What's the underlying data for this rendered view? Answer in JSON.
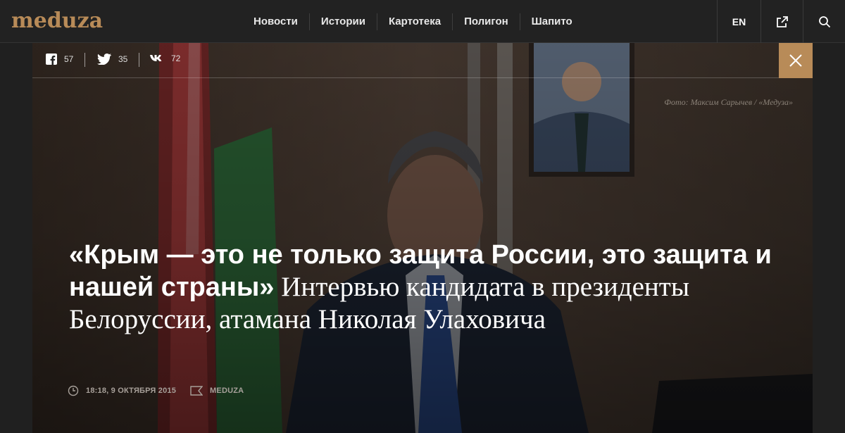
{
  "header": {
    "logo": "meduza",
    "nav": [
      "Новости",
      "Истории",
      "Картотека",
      "Полигон",
      "Шапито"
    ],
    "lang": "EN"
  },
  "share": {
    "facebook_count": "57",
    "twitter_count": "35",
    "vk_count": "72"
  },
  "article": {
    "photo_credit": "Фото: Максим Сарычев / «Медуза»",
    "title_main": "«Крым — это не только защита России, это защита и нашей страны»",
    "title_sub": " Интервью кандидата в президенты Белоруссии, атамана Николая Улаховича",
    "timestamp": "18:18, 9 октября 2015",
    "source": "MEDUZA"
  },
  "colors": {
    "accent": "#b88b58",
    "nav_bg": "#222222"
  },
  "icons": [
    "external-link-icon",
    "search-icon",
    "facebook-icon",
    "twitter-icon",
    "vk-icon",
    "close-icon",
    "clock-icon",
    "bookmark-icon"
  ]
}
